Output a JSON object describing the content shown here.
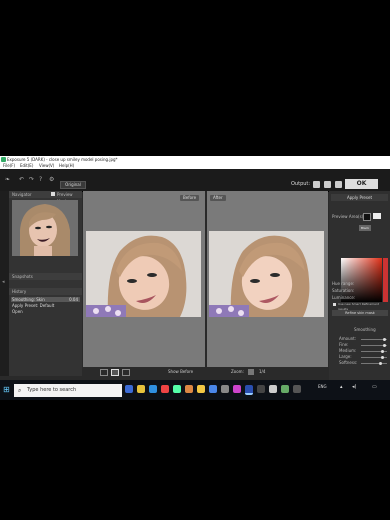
{
  "window": {
    "title": "Exposure 5 (DARK) - close up smiley model posing.jpg*",
    "menu": [
      "File(F)",
      "Edit(E)",
      "View(V)",
      "Help(H)"
    ]
  },
  "toolbar": {
    "compare_label": "Original",
    "output_label": "Output:",
    "ok_label": "OK"
  },
  "left_panel": {
    "navigator_label": "Navigator",
    "preview_label": "Preview Mask",
    "snapshots_label": "Snapshots",
    "history_label": "History",
    "history_items": [
      {
        "label": "Smoothing: Skin",
        "value": "0.04"
      },
      {
        "label": "Apply Preset: Default",
        "value": ""
      },
      {
        "label": "Open",
        "value": ""
      }
    ]
  },
  "center": {
    "before_label": "Before",
    "after_label": "After",
    "show_before_label": "Show Before",
    "zoom_label": "Zoom:",
    "zoom_value": "1/4"
  },
  "right_panel": {
    "apply_preset_label": "Apply Preset",
    "preview_area_label": "Preview Area(s):",
    "tab_label": "Black",
    "rows": [
      "Hue range:",
      "Saturation:",
      "Luminance:"
    ],
    "checkbox_label": "Use new Smart Refinement results",
    "refine_button": "Refine skin mask",
    "section_label": "Smoothing",
    "sliders": [
      "Amount:",
      "Fine:",
      "Medium:",
      "Large:",
      "Softness:"
    ]
  },
  "taskbar": {
    "search_placeholder": "Type here to search",
    "tray_text": "ENG"
  }
}
